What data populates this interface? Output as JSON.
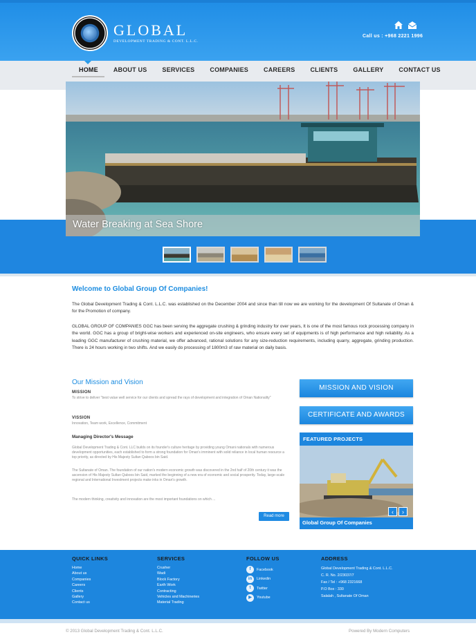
{
  "header": {
    "logo_title": "GLOBAL",
    "logo_subtitle": "DEVELOPMENT TRADING & CONT. L.L.C.",
    "call": "Call us : +968 2221 1996",
    "icons": [
      "home-icon",
      "mail-icon"
    ]
  },
  "nav": {
    "items": [
      "HOME",
      "ABOUT US",
      "SERVICES",
      "COMPANIES",
      "CAREERS",
      "CLIENTS",
      "GALLERY",
      "CONTACT US"
    ],
    "active": "HOME"
  },
  "slider": {
    "caption": "Water Breaking at Sea Shore",
    "thumb_count": 5,
    "active_thumb": 1
  },
  "welcome": {
    "title": "Welcome to Global Group Of Companies!",
    "p1": "The Global Development Trading & Cont. L.L.C. was established on the December 2004 and since than till now we are working for the development Of Sultanate of Oman & for the Promotion of company.",
    "p2": "GLOBAL GROUP OF COMPANIES GGC has been serving the aggregate crushing & grinding industry for over years, It is one of the most famous rock processing company in the world. GGC has a group of bright-wise workers and experienced on-site engineers, who ensure every set of equipments is of high performance and high reliability. As a leading GGC manufacturer of crushing material, we offer advanced, rational solutions for any size-reduction requirements, including quarry, aggregate, grinding production. There is 24 hours working in two shifts. And we easily do processing of 1800m3 of raw material on daily basis."
  },
  "mission": {
    "title": "Our Mission and Vision",
    "mission_label": "MISSION",
    "mission_text": "To strive to deliver \"best value well service for our clients and spread the rays of development and integration of Oman Nationality\"",
    "vision_label": "VISSION",
    "vision_text": "Innovation, Team work, Excellence, Commitment",
    "director_title": "Managing Director's Message",
    "director_p1": "Global Development Trading & Cont. LLC builds on its founder's culture heritage by providing young Omani nationals with numerous development opportunities, each established to form a strong foundation for Oman's imminent with solid reliance in local human resource a top priority, as directed by His Majesty Sultan Qaboos bin Said.",
    "director_p2": "The Sultanate of Oman. The foundation of our nation's modern economic growth was discovered in the 2nd half of 20th century it was the ascension of His Majesty Sultan Qaboos bin Said, marked the beginning of a new era of economic and social prosperity. Today, large-scale regional and International Investment projects make inks in Oman's growth.",
    "director_p3": "The modern thinking, creativity and innovation are the most important foundations on which ...",
    "read_more": "Read more"
  },
  "sidebar": {
    "btn_mission": "MISSION AND VISION",
    "btn_certificate": "CERTIFICATE AND AWARDS",
    "featured_title": "FEATURED PROJECTS",
    "featured_caption": "Global Group Of Companies",
    "prev": "‹",
    "next": "›"
  },
  "footer": {
    "quick_links_title": "QUICK LINKS",
    "quick_links": [
      "Home",
      "About us",
      "Companies",
      "Careers",
      "Clients",
      "Gallery",
      "Contact us"
    ],
    "services_title": "SERVICES",
    "services": [
      "Crusher",
      "Wadi",
      "Block Factory",
      "Earth Work",
      "Contracting",
      "Vehicles and Machineries",
      "Material Trading"
    ],
    "follow_title": "FOLLOW US",
    "social": [
      {
        "label": "Facebook",
        "glyph": "f"
      },
      {
        "label": "Linkedin",
        "glyph": "in"
      },
      {
        "label": "Twitter",
        "glyph": "t"
      },
      {
        "label": "Youtube",
        "glyph": "▶"
      }
    ],
    "address_title": "ADDRESS",
    "address": [
      "Global Development Trading & Cont. L.L.C.",
      "C. R. No. 2/23037/7",
      "Fax / Tel : +968 2321668",
      "P.O Box : 330",
      "Salalah , Sultanate Of Oman"
    ],
    "copyright": "© 2013 Global Development Trading & Cont. L.L.C.",
    "powered": "Powered By Modern Computers"
  },
  "colors": {
    "brand_blue": "#1d86de",
    "title_blue": "#1b8ce0"
  }
}
